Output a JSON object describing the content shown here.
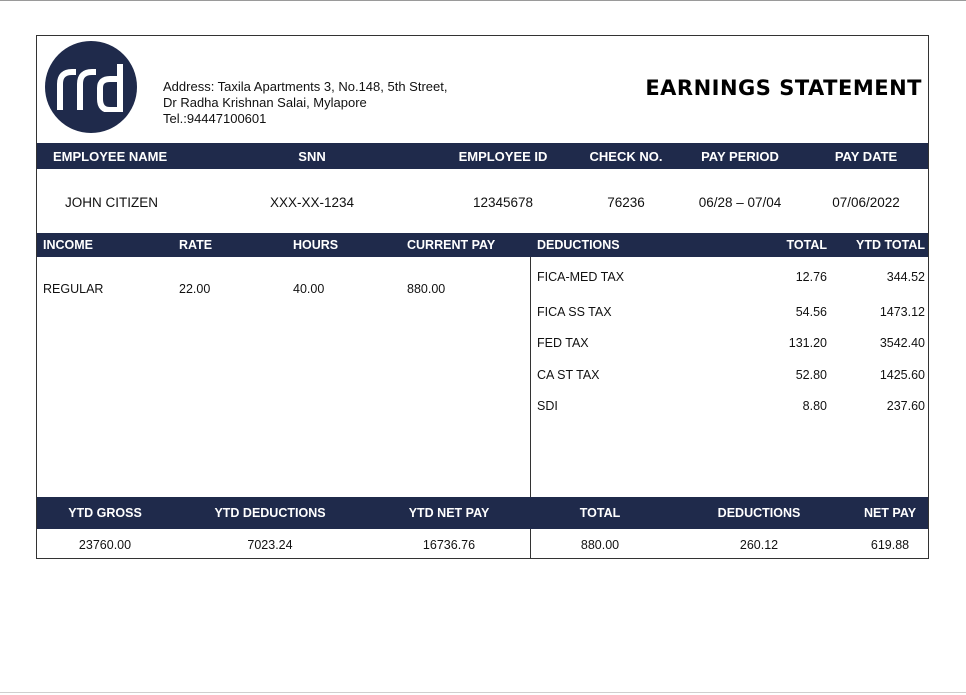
{
  "company": {
    "logo_text": "rrd",
    "address_line1": "Address: Taxila Apartments 3, No.148, 5th Street,",
    "address_line2": "Dr Radha  Krishnan  Salai,  Mylapore",
    "phone": "Tel.:94447100601"
  },
  "title": "EARNINGS STATEMENT",
  "employee_headers": {
    "name": "EMPLOYEE NAME",
    "ssn": "SNN",
    "employee_id": "EMPLOYEE ID",
    "check_no": "CHECK NO.",
    "pay_period": "PAY PERIOD",
    "pay_date": "PAY DATE"
  },
  "employee": {
    "name": "JOHN CITIZEN",
    "ssn": "XXX-XX-1234",
    "employee_id": "12345678",
    "check_no": "76236",
    "pay_period": "06/28 – 07/04",
    "pay_date": "07/06/2022"
  },
  "income_headers": {
    "income": "INCOME",
    "rate": "RATE",
    "hours": "HOURS",
    "current_pay": "CURRENT PAY"
  },
  "income_rows": [
    {
      "income": "REGULAR",
      "rate": "22.00",
      "hours": "40.00",
      "current_pay": "880.00"
    }
  ],
  "deduction_headers": {
    "deductions": "DEDUCTIONS",
    "total": "TOTAL",
    "ytd_total": "YTD TOTAL"
  },
  "deductions": [
    {
      "name": "FICA-MED TAX",
      "total": "12.76",
      "ytd": "344.52"
    },
    {
      "name": "FICA SS TAX",
      "total": "54.56",
      "ytd": "1473.12"
    },
    {
      "name": "FED TAX",
      "total": "131.20",
      "ytd": "3542.40"
    },
    {
      "name": "CA ST TAX",
      "total": "52.80",
      "ytd": "1425.60"
    },
    {
      "name": "SDI",
      "total": "8.80",
      "ytd": "237.60"
    }
  ],
  "summary_headers": {
    "ytd_gross": "YTD GROSS",
    "ytd_deductions": "YTD DEDUCTIONS",
    "ytd_net_pay": "YTD NET PAY",
    "total": "TOTAL",
    "deductions": "DEDUCTIONS",
    "net_pay": "NET PAY"
  },
  "summary": {
    "ytd_gross": "23760.00",
    "ytd_deductions": "7023.24",
    "ytd_net_pay": "16736.76",
    "total": "880.00",
    "deductions": "260.12",
    "net_pay": "619.88"
  },
  "colors": {
    "band": "#1f2a4b",
    "logo": "#1f2a4b"
  }
}
